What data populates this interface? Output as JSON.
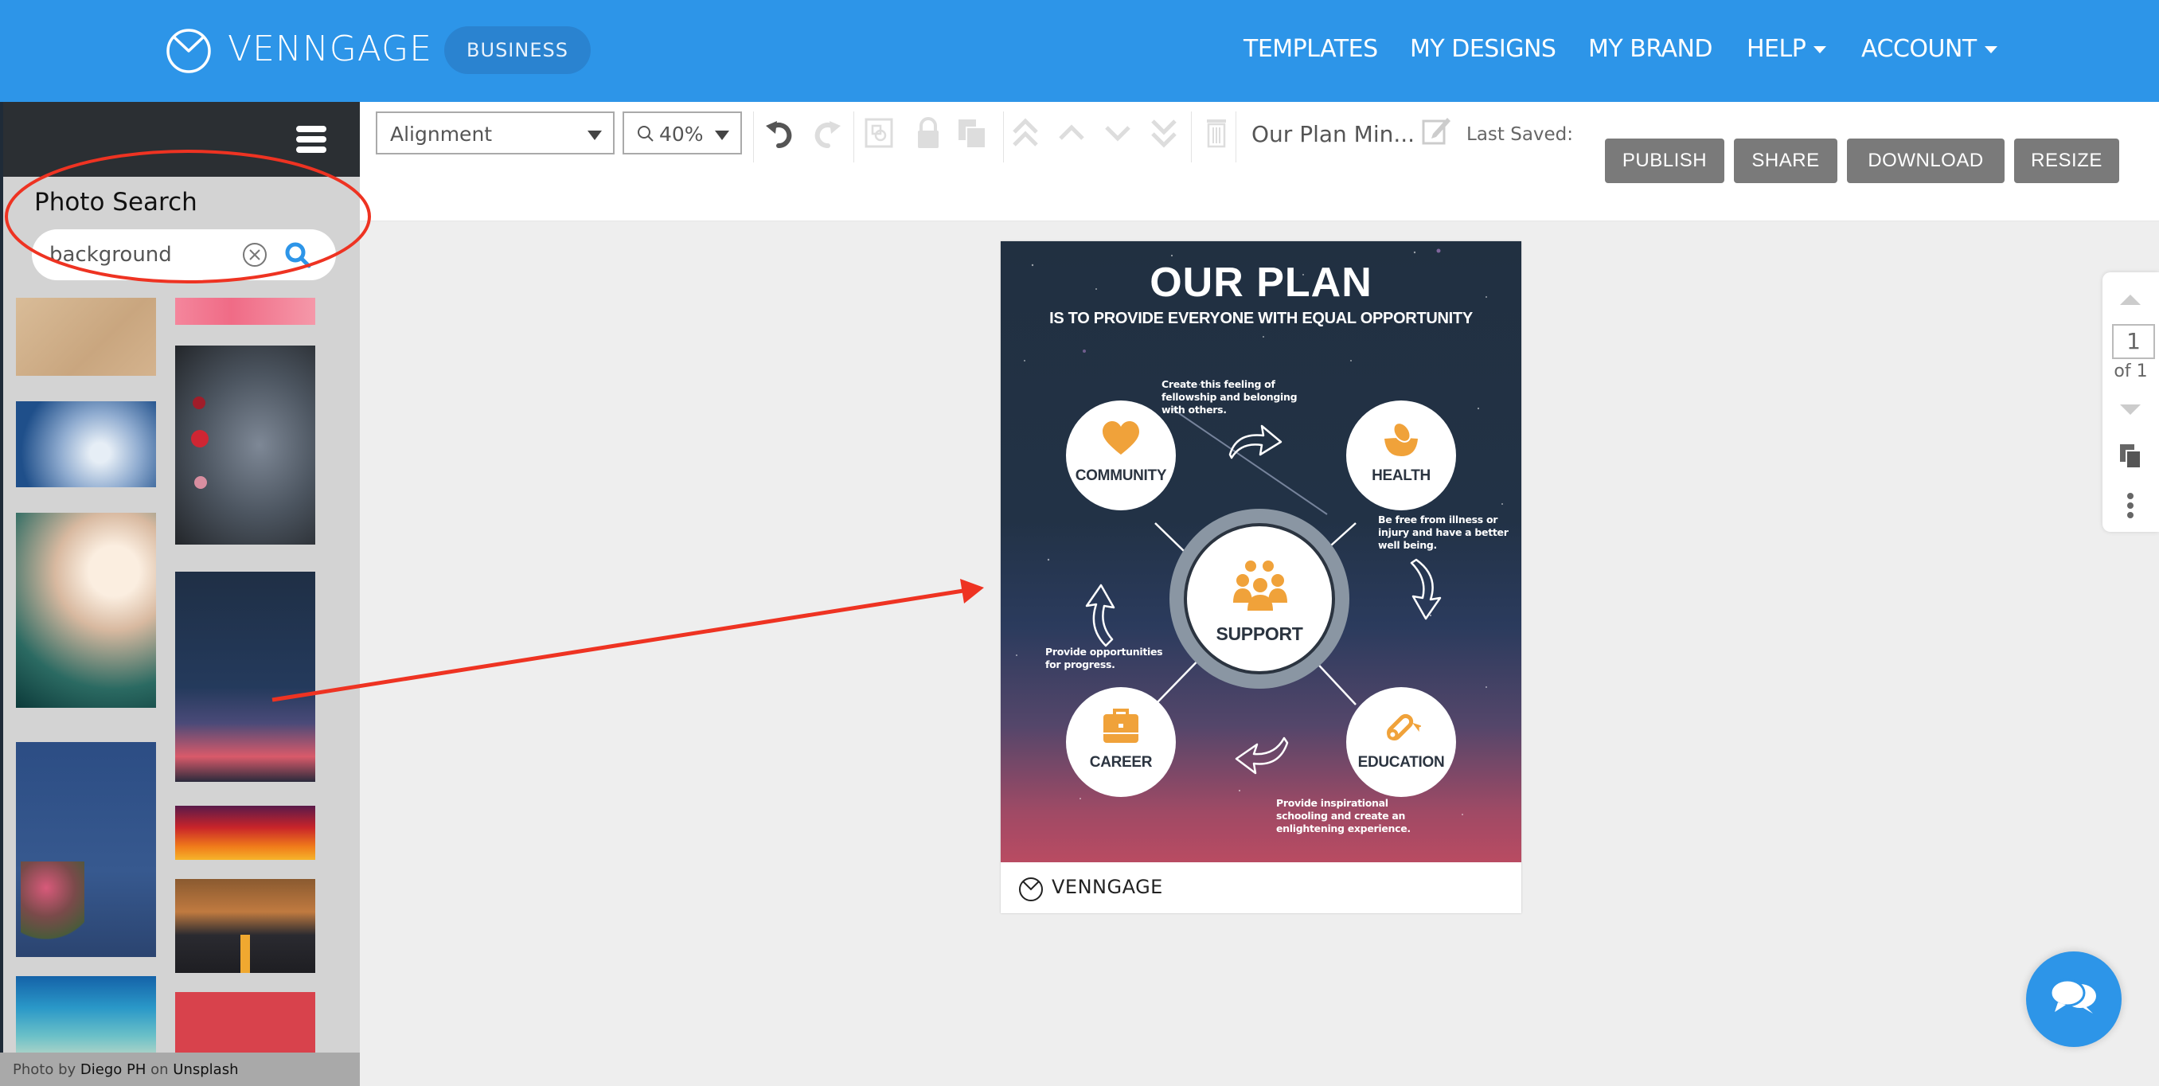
{
  "app": {
    "brand": "VENNGAGE",
    "plan_badge": "BUSINESS",
    "brand_color": "#2d95e8"
  },
  "nav": {
    "items": [
      {
        "label": "TEMPLATES",
        "has_dropdown": false
      },
      {
        "label": "MY DESIGNS",
        "has_dropdown": false
      },
      {
        "label": "MY BRAND",
        "has_dropdown": false
      },
      {
        "label": "HELP",
        "has_dropdown": true
      },
      {
        "label": "ACCOUNT",
        "has_dropdown": true
      }
    ]
  },
  "sidebar": {
    "menu_icon": "hamburger-icon",
    "panel_title": "Photo Search",
    "search": {
      "value": "background",
      "placeholder": "",
      "clear_icon": "clear-circle-x-icon",
      "search_icon": "magnifier-icon"
    },
    "results": [
      {
        "description": "tan paper texture"
      },
      {
        "description": "pink watercolor"
      },
      {
        "description": "blue water splash"
      },
      {
        "description": "dark grey wall with roses"
      },
      {
        "description": "teal bokeh lights"
      },
      {
        "description": "night sky with shooting star over sunset"
      },
      {
        "description": "blue wall with flower bouquet"
      },
      {
        "description": "red orange sunset sky"
      },
      {
        "description": "autumn forest road"
      },
      {
        "description": "turquoise sea"
      },
      {
        "description": "red wall"
      }
    ],
    "attribution": {
      "prefix": "Photo by",
      "author": "Diego PH",
      "middle": "on",
      "source": "Unsplash"
    }
  },
  "toolbar": {
    "alignment_label": "Alignment",
    "zoom_label": "40%",
    "icons": [
      "undo-icon",
      "redo-icon",
      "group-icon",
      "lock-icon",
      "duplicate-icon",
      "bring-to-front-icon",
      "bring-forward-icon",
      "send-backward-icon",
      "send-to-back-icon",
      "trash-icon"
    ],
    "doc_title": "Our Plan Min...",
    "last_saved_label": "Last Saved:",
    "buttons": {
      "publish": "PUBLISH",
      "share": "SHARE",
      "download": "DOWNLOAD",
      "resize": "RESIZE"
    }
  },
  "design": {
    "title": "OUR PLAN",
    "subtitle": "IS TO PROVIDE EVERYONE WITH EQUAL OPPORTUNITY",
    "accent_color": "#f0a23a",
    "center": {
      "label": "SUPPORT",
      "icon": "group-people-icon"
    },
    "nodes": [
      {
        "label": "COMMUNITY",
        "icon": "heart-icon",
        "description": "Create this feeling of fellowship and belonging with others."
      },
      {
        "label": "HEALTH",
        "icon": "fruit-bowl-icon",
        "description": "Be free from illness or injury and have a better well being."
      },
      {
        "label": "CAREER",
        "icon": "briefcase-icon",
        "description": "Provide opportunities for progress."
      },
      {
        "label": "EDUCATION",
        "icon": "diploma-icon",
        "description": "Provide inspirational schooling and create an enlightening experience."
      }
    ],
    "desc_lines": {
      "community": [
        "Create this feeling of",
        "fellowship and belonging",
        "with others."
      ],
      "health": [
        "Be free from illness or",
        "injury and have a better",
        "well being."
      ],
      "career": [
        "Provide opportunities",
        "for progress."
      ],
      "education": [
        "Provide inspirational",
        "schooling and create an",
        "enlightening experience."
      ]
    },
    "footer_brand": "VENNGAGE"
  },
  "pages": {
    "current": "1",
    "total_label": "of 1"
  },
  "chat": {
    "icon": "chat-bubbles-icon"
  },
  "annotations": {
    "highlight_color": "#ee3322"
  }
}
